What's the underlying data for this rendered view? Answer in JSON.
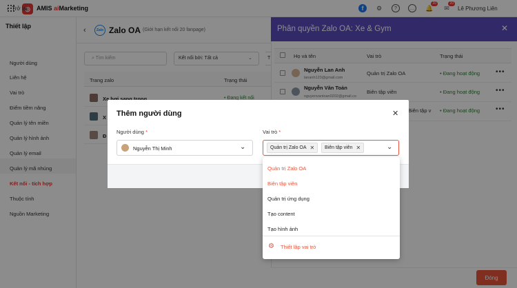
{
  "topbar": {
    "brand_prefix": "AMIS ",
    "brand_ai": "ai",
    "brand_suffix": "Marketing",
    "notif_badge": "20",
    "mail_badge": "20",
    "user_name": "Lê Phương Liên"
  },
  "sidebar": {
    "back": "Trở lại",
    "title": "Thiết lập",
    "items": [
      "Người dùng",
      "Liên hệ",
      "Vai trò",
      "Điểm tiềm năng",
      "Quản lý tên miền",
      "Quản lý hình ảnh",
      "Quản lý email",
      "Quản lý mã nhúng",
      "Kết nối - tích hợp",
      "Thuộc tính",
      "Nguồn Marketing"
    ],
    "active_index": 8
  },
  "main": {
    "zalo_icon_text": "Zalo",
    "title": "Zalo OA",
    "subtitle": "(Giới hạn kết nối 20 fanpage)",
    "search_placeholder": "Tìm kiếm",
    "filter_label": "Kết nối bởi: Tất cả",
    "filter2_label": "T",
    "col_page": "Trang zalo",
    "col_status": "Trạng thái",
    "rows": [
      {
        "name": "Xe hơi sang trọng",
        "status": "• Đang kết nối"
      },
      {
        "name": "X",
        "status": ""
      },
      {
        "name": "Đ",
        "status": ""
      }
    ]
  },
  "drawer": {
    "title": "Phân quyền Zalo OA: Xe & Gym",
    "col_name": "Họ và tên",
    "col_role": "Vai trò",
    "col_status": "Trạng thái",
    "rows": [
      {
        "name": "Nguyễn Lan Anh",
        "email": "lananh123@gmail.com",
        "role": "Quản trị Zalo OA",
        "status": "Đang hoạt động"
      },
      {
        "name": "Nguyễn Văn Toản",
        "email": "nguyenvantoan0202@gmail.co",
        "role": "Biên tập viên",
        "status": "Đang hoạt động"
      },
      {
        "name": "",
        "email": "",
        "role": "Biên tập v",
        "status": "Đang hoạt động"
      }
    ],
    "save_label": "Đóng"
  },
  "modal": {
    "title": "Thêm người dùng",
    "user_label": "Người dùng",
    "role_label": "Vai trò",
    "required_mark": "*",
    "user_value": "Nguyễn Thị Minh",
    "role_tags": [
      "Quản trị Zalo OA",
      "Biên tập viên"
    ]
  },
  "dropdown": {
    "options": [
      {
        "label": "Quản trị Zalo OA",
        "selected": true
      },
      {
        "label": "Biên tập viên",
        "selected": true
      },
      {
        "label": "Quản trị ứng dụng",
        "selected": false
      },
      {
        "label": "Tạo content",
        "selected": false
      },
      {
        "label": "Tạo hình ảnh",
        "selected": false
      }
    ],
    "settings_link": "Thiết lập vai trò"
  },
  "colors": {
    "accent": "#e8553b",
    "drawer_header": "#5c4dbd",
    "status_green": "#2e7d32"
  }
}
